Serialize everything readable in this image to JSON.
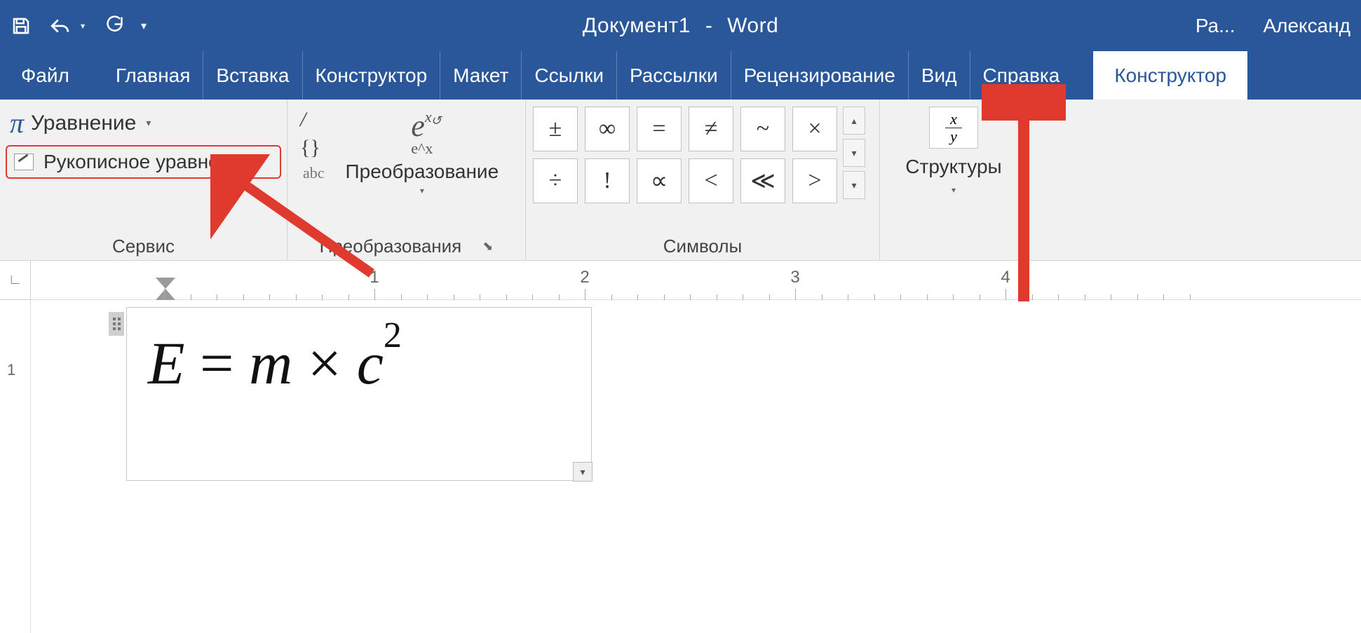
{
  "title": {
    "doc": "Документ1",
    "app": "Word",
    "trunc": "Ра...",
    "user": "Александ"
  },
  "tabs": [
    {
      "label": "Файл"
    },
    {
      "label": "Главная"
    },
    {
      "label": "Вставка"
    },
    {
      "label": "Конструктор"
    },
    {
      "label": "Макет"
    },
    {
      "label": "Ссылки"
    },
    {
      "label": "Рассылки"
    },
    {
      "label": "Рецензирование"
    },
    {
      "label": "Вид"
    },
    {
      "label": "Справка"
    },
    {
      "label": "Конструктор",
      "active": true
    }
  ],
  "ribbon": {
    "tools": {
      "equation_label": "Уравнение",
      "ink_label": "Рукописное уравнение",
      "group_label": "Сервис"
    },
    "conversions": {
      "convert_label": "Преобразование",
      "abc": "abc",
      "group_label": "Преобразования"
    },
    "symbols": {
      "row1": [
        "±",
        "∞",
        "=",
        "≠",
        "~",
        "×"
      ],
      "row2": [
        "÷",
        "!",
        "∝",
        "<",
        "≪",
        ">"
      ],
      "group_label": "Символы"
    },
    "structures": {
      "label": "Структуры"
    }
  },
  "ruler": {
    "numbers": [
      "1",
      "2",
      "3",
      "4"
    ]
  },
  "equation": {
    "E": "E",
    "eq": " = ",
    "m": "m",
    "times": " × ",
    "c": "c",
    "sup": "2"
  },
  "vruler_label": "1",
  "colors": {
    "accent": "#2a579a",
    "highlight": "#e03a2f"
  }
}
